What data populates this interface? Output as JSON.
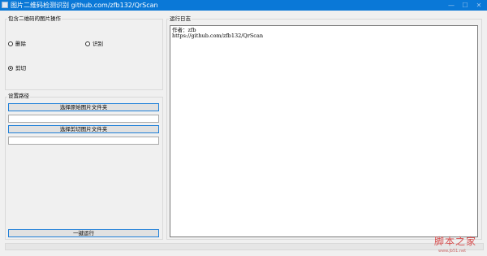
{
  "window": {
    "title": "图片二维码检测识别 github.com/zfb132/QrScan",
    "controls": {
      "minimize": "—",
      "maximize": "☐",
      "close": "✕"
    }
  },
  "ops_group": {
    "label": "包含二维码的图片操作",
    "radios": [
      {
        "label": "删除",
        "checked": false
      },
      {
        "label": "识别",
        "checked": false
      },
      {
        "label": "剪切",
        "checked": true
      }
    ]
  },
  "path_group": {
    "label": "设置路径",
    "select_source_button": "选择原始图片文件夹",
    "source_path_value": "",
    "select_cut_button": "选择剪切图片文件夹",
    "cut_path_value": ""
  },
  "run_button": "一键运行",
  "log_group": {
    "label": "运行日志",
    "lines": [
      "作者：zfb",
      "https://github.com/zfb132/QrScan"
    ]
  },
  "watermark": {
    "text": "脚本之家",
    "sub": "www.jb51.net"
  },
  "colors": {
    "titlebar": "#0a78d7",
    "button_border": "#1e7fd8"
  }
}
